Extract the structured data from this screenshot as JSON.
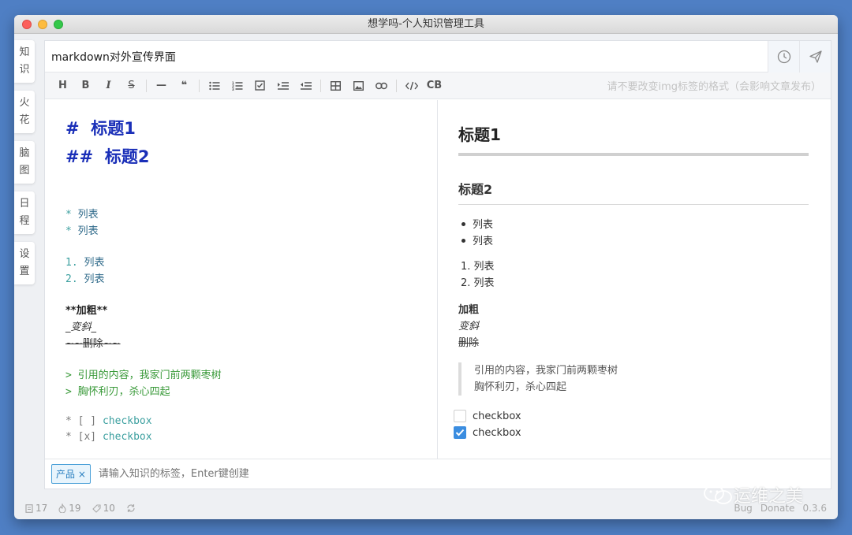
{
  "window": {
    "title": "想学吗-个人知识管理工具"
  },
  "sidebar": {
    "tabs": [
      {
        "label": [
          "知",
          "识"
        ]
      },
      {
        "label": [
          "火",
          "花"
        ]
      },
      {
        "label": [
          "脑",
          "图"
        ]
      },
      {
        "label": [
          "日",
          "程"
        ]
      },
      {
        "label": [
          "设",
          "置"
        ]
      }
    ]
  },
  "doc": {
    "title_value": "markdown对外宣传界面"
  },
  "toolbar": {
    "hint": "请不要改变img标签的格式（会影响文章发布）",
    "buttons": [
      "H",
      "B",
      "I",
      "S",
      "—",
      "❝",
      "ul",
      "ol",
      "task",
      "indent",
      "outdent",
      "table",
      "image",
      "link",
      "code",
      "CB"
    ]
  },
  "editor": {
    "h1": "#  标题1",
    "h2": "##  标题2",
    "ul_marker": "* ",
    "ul_items": [
      "列表",
      "列表"
    ],
    "ol_items": [
      {
        "marker": "1. ",
        "text": "列表"
      },
      {
        "marker": "2. ",
        "text": "列表"
      }
    ],
    "bold": "**加粗**",
    "italic": "_变斜_",
    "strike": "~~删除~~",
    "quote_marker": "> ",
    "quote_lines": [
      "引用的内容，我家门前两颗枣树",
      "胸怀利刃，杀心四起"
    ],
    "checks": [
      {
        "prefix": "* [ ] ",
        "text": "checkbox"
      },
      {
        "prefix": "* [x] ",
        "text": "checkbox"
      }
    ]
  },
  "preview": {
    "h1": "标题1",
    "h2": "标题2",
    "ul_items": [
      "列表",
      "列表"
    ],
    "ol_items": [
      "1. 列表",
      "2. 列表"
    ],
    "bold": "加粗",
    "italic": "变斜",
    "strike": "删除",
    "quote_lines": [
      "引用的内容，我家门前两颗枣树",
      "胸怀利刃，杀心四起"
    ],
    "checks": [
      {
        "text": "checkbox",
        "checked": false
      },
      {
        "text": "checkbox",
        "checked": true
      }
    ]
  },
  "tags": {
    "items": [
      "产品 ×"
    ],
    "placeholder": "请输入知识的标签，Enter键创建"
  },
  "status": {
    "docs": "17",
    "sparks": "19",
    "tags": "10",
    "bug": "Bug",
    "donate": "Donate",
    "version": "0.3.6"
  },
  "watermark": {
    "text": "运维之美"
  },
  "colors": {
    "accent": "#3b8de0",
    "heading": "#1a2fb8",
    "quote": "#3a9a3a"
  }
}
